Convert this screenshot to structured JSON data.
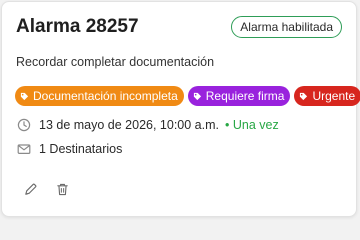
{
  "alarm": {
    "title": "Alarma 28257",
    "status_badge": "Alarma habilitada",
    "description": "Recordar completar documentación",
    "tags": [
      {
        "label": "Documentación incompleta",
        "color": "#f08a14",
        "icon": "tag-icon"
      },
      {
        "label": "Requiere firma",
        "color": "#9922dd",
        "icon": "tag-icon"
      },
      {
        "label": "Urgente",
        "color": "#d7261e",
        "icon": "tag-icon"
      }
    ],
    "schedule": {
      "icon": "clock-icon",
      "datetime": "13 de mayo de 2026, 10:00 a.m.",
      "repeat": "• Una vez",
      "repeat_color": "#28a745"
    },
    "recipients": {
      "icon": "mail-icon",
      "text": "1 Destinatarios"
    },
    "actions": {
      "edit_icon": "pencil-icon",
      "delete_icon": "trash-icon"
    }
  },
  "colors": {
    "badge_border": "#2e9d57",
    "card_background": "#ffffff"
  }
}
